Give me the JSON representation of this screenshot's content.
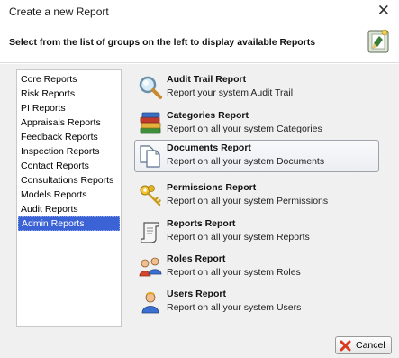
{
  "window": {
    "title": "Create a new Report",
    "close_glyph": "✕"
  },
  "header": {
    "instruction": "Select from the list of groups on the left to display available Reports",
    "icon": "wizard-icon"
  },
  "groups": [
    {
      "label": "Core Reports",
      "selected": false
    },
    {
      "label": "Risk Reports",
      "selected": false
    },
    {
      "label": "PI Reports",
      "selected": false
    },
    {
      "label": "Appraisals Reports",
      "selected": false
    },
    {
      "label": "Feedback Reports",
      "selected": false
    },
    {
      "label": "Inspection Reports",
      "selected": false
    },
    {
      "label": "Contact Reports",
      "selected": false
    },
    {
      "label": "Consultations Reports",
      "selected": false
    },
    {
      "label": "Models Reports",
      "selected": false
    },
    {
      "label": "Audit Reports",
      "selected": false
    },
    {
      "label": "Admin Reports",
      "selected": true
    }
  ],
  "reports": [
    {
      "title": "Audit Trail Report",
      "description": "Report your system Audit Trail",
      "icon": "magnifier-icon"
    },
    {
      "title": "Categories Report",
      "description": "Report on all your system Categories",
      "icon": "books-icon"
    },
    {
      "title": "Documents Report",
      "description": "Report on all your system Documents",
      "icon": "documents-icon",
      "hovered": true
    },
    {
      "title": "Permissions Report",
      "description": "Report on all your system Permissions",
      "icon": "keys-icon"
    },
    {
      "title": "Reports Report",
      "description": "Report on all your system Reports",
      "icon": "scroll-icon"
    },
    {
      "title": "Roles Report",
      "description": "Report on all your system Roles",
      "icon": "users-group-icon"
    },
    {
      "title": "Users Report",
      "description": "Report on all your system Users",
      "icon": "user-icon"
    }
  ],
  "footer": {
    "cancel_label": "Cancel",
    "cancel_icon": "red-x-icon"
  },
  "colors": {
    "selection": "#3c63d6",
    "dialog_bg": "#f0f0f0",
    "cancel_icon": "#d93a1f"
  }
}
